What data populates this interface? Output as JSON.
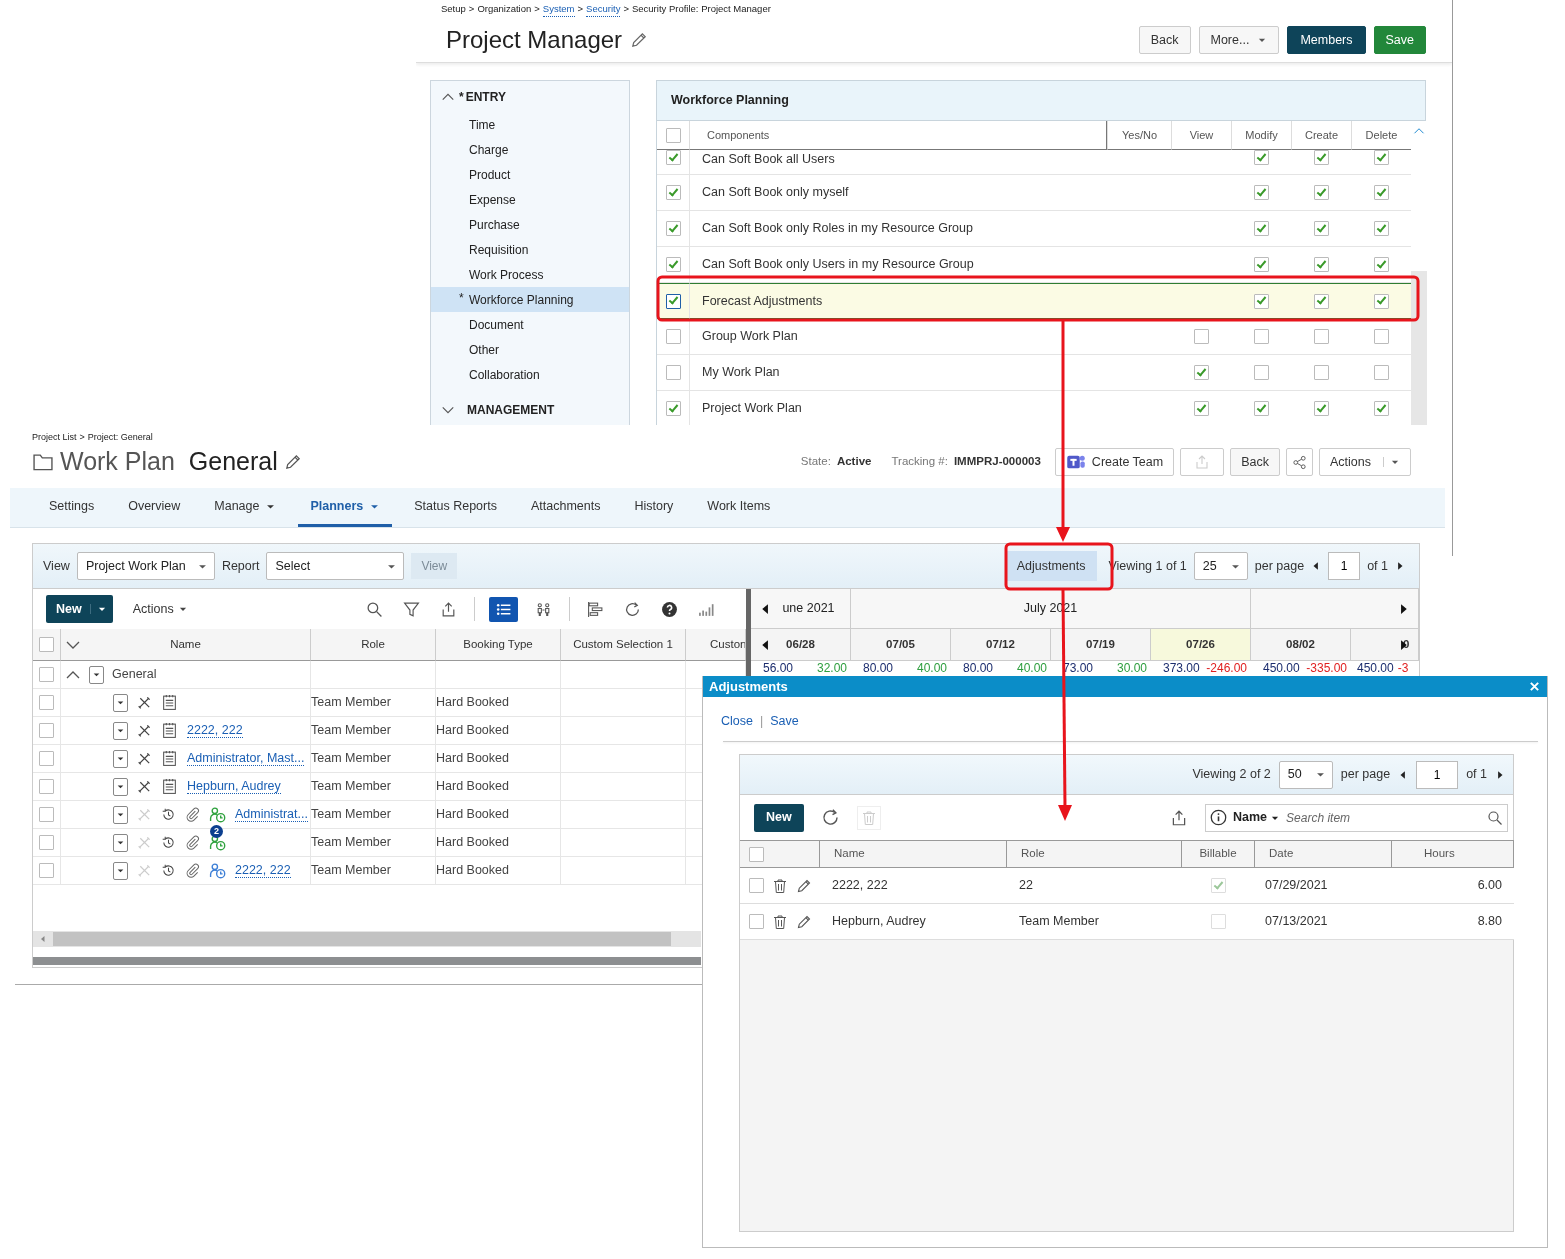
{
  "security_profile": {
    "breadcrumb": {
      "separator": ">",
      "items": [
        {
          "text": "Setup",
          "link": false
        },
        {
          "text": "Organization",
          "link": false
        },
        {
          "text": "System",
          "link": true
        },
        {
          "text": "Security",
          "link": true
        },
        {
          "text": "Security Profile: Project Manager",
          "link": false
        }
      ]
    },
    "title": "Project Manager",
    "buttons": [
      {
        "label": "Back",
        "kind": "default"
      },
      {
        "label": "More...",
        "kind": "dropdown"
      },
      {
        "label": "Members",
        "kind": "dark"
      },
      {
        "label": "Save",
        "kind": "success"
      }
    ],
    "required_mark": "*",
    "sidebar": [
      {
        "label": "ENTRY",
        "required": true,
        "expanded": true,
        "items": [
          {
            "label": "Time",
            "required": false,
            "selected": false
          },
          {
            "label": "Charge",
            "required": false,
            "selected": false
          },
          {
            "label": "Product",
            "required": false,
            "selected": false
          },
          {
            "label": "Expense",
            "required": false,
            "selected": false
          },
          {
            "label": "Purchase",
            "required": false,
            "selected": false
          },
          {
            "label": "Requisition",
            "required": false,
            "selected": false
          },
          {
            "label": "Work Process",
            "required": false,
            "selected": false
          },
          {
            "label": "Workforce Planning",
            "required": true,
            "selected": true
          },
          {
            "label": "Document",
            "required": false,
            "selected": false
          },
          {
            "label": "Other",
            "required": false,
            "selected": false
          },
          {
            "label": "Collaboration",
            "required": false,
            "selected": false
          }
        ]
      },
      {
        "label": "MANAGEMENT",
        "required": false,
        "expanded": false
      }
    ],
    "panel": {
      "title": "Workforce Planning",
      "header_checked": false,
      "columns": [
        "Components",
        "Yes/No",
        "View",
        "Modify",
        "Create",
        "Delete"
      ],
      "rows": [
        {
          "label": "Can Soft Book all Users",
          "checked": true,
          "selected": false,
          "permissions": {
            "modify": true,
            "create": true,
            "delete": true
          }
        },
        {
          "label": "Can Soft Book only myself",
          "checked": true,
          "selected": false,
          "permissions": {
            "modify": true,
            "create": true,
            "delete": true
          }
        },
        {
          "label": "Can Soft Book only Roles in my Resource Group",
          "checked": true,
          "selected": false,
          "permissions": {
            "modify": true,
            "create": true,
            "delete": true
          }
        },
        {
          "label": "Can Soft Book only Users in my Resource Group",
          "checked": true,
          "selected": false,
          "permissions": {
            "modify": true,
            "create": true,
            "delete": true
          }
        },
        {
          "label": "Forecast Adjustments",
          "checked": true,
          "selected": true,
          "permissions": {
            "modify": true,
            "create": true,
            "delete": true
          }
        },
        {
          "label": "Group Work Plan",
          "checked": false,
          "selected": false,
          "permissions": {
            "view": false,
            "modify": false,
            "create": false,
            "delete": false
          }
        },
        {
          "label": "My Work Plan",
          "checked": false,
          "selected": false,
          "permissions": {
            "view": true,
            "modify": false,
            "create": false,
            "delete": false
          }
        },
        {
          "label": "Project Work Plan",
          "checked": true,
          "selected": false,
          "permissions": {
            "view": true,
            "modify": true,
            "create": true,
            "delete": true
          }
        }
      ]
    }
  },
  "work_plan": {
    "breadcrumb": {
      "separator": ">",
      "items": [
        {
          "text": "Project List",
          "link": false
        },
        {
          "text": "Project: General",
          "link": false
        }
      ]
    },
    "title_prefix": "Work Plan",
    "title": "General",
    "state_label": "State:",
    "state": "Active",
    "tracking_label": "Tracking #:",
    "tracking": "IMMPRJ-000003",
    "buttons": [
      {
        "label": "Create Team",
        "kind": "teams"
      },
      {
        "kind": "upload",
        "disabled": true
      },
      {
        "label": "Back",
        "kind": "default"
      },
      {
        "kind": "share"
      },
      {
        "label": "Actions",
        "kind": "split"
      }
    ],
    "tabs": [
      {
        "label": "Settings",
        "selected": false,
        "dropdown": false
      },
      {
        "label": "Overview",
        "selected": false,
        "dropdown": false
      },
      {
        "label": "Manage",
        "selected": false,
        "dropdown": true
      },
      {
        "label": "Planners",
        "selected": true,
        "dropdown": true
      },
      {
        "label": "Status Reports",
        "selected": false,
        "dropdown": false
      },
      {
        "label": "Attachments",
        "selected": false,
        "dropdown": false
      },
      {
        "label": "History",
        "selected": false,
        "dropdown": false
      },
      {
        "label": "Work Items",
        "selected": false,
        "dropdown": false
      }
    ],
    "toolbar": {
      "view_label": "View",
      "view_select": "Project Work Plan",
      "report_label": "Report",
      "report_select": "Select",
      "view_button": {
        "label": "View",
        "disabled": true
      },
      "adjustments_button": "Adjustments",
      "viewing": "Viewing 1 of 1",
      "per_page": "25",
      "per_page_label": "per page",
      "page": "1",
      "page_total": "of 1"
    },
    "grid": {
      "new_button": "New",
      "actions_button": "Actions",
      "header_checked": false,
      "columns": [
        "Name",
        "Role",
        "Booking Type",
        "Custom Selection 1",
        "Custon"
      ],
      "group": {
        "label": "General",
        "expanded": true,
        "checked": false
      },
      "rows": [
        {
          "kind": "resource",
          "checked": false,
          "role": "Team Member",
          "booking": "Hard Booked"
        },
        {
          "kind": "resource",
          "checked": false,
          "name": "2222, 222",
          "role": "Team Member",
          "booking": "Hard Booked"
        },
        {
          "kind": "resource",
          "checked": false,
          "name": "Administrator, Mast...",
          "role": "Team Member",
          "booking": "Hard Booked"
        },
        {
          "kind": "resource",
          "checked": false,
          "name": "Hepburn, Audrey",
          "role": "Team Member",
          "booking": "Hard Booked"
        },
        {
          "kind": "assignment",
          "checked": false,
          "name": "Administrat...",
          "color": "#2fa23e",
          "role": "Team Member",
          "booking": "Hard Booked"
        },
        {
          "kind": "assignment",
          "checked": false,
          "color": "#2fa23e",
          "badge": "2",
          "role": "Team Member",
          "booking": "Hard Booked"
        },
        {
          "kind": "assignment",
          "checked": false,
          "name": "2222, 222",
          "color": "#3d7fd6",
          "role": "Team Member",
          "booking": "Hard Booked"
        }
      ]
    },
    "timeline": {
      "months": [
        {
          "label": "une 2021",
          "weeks": [
            {
              "label": "06/28",
              "current": false,
              "values": [
                {
                  "text": "56.00",
                  "color": "#1c2d6e"
                },
                {
                  "text": "32.00",
                  "color": "#2e9e3e"
                }
              ]
            }
          ]
        },
        {
          "label": "July 2021",
          "weeks": [
            {
              "label": "07/05",
              "current": false,
              "values": [
                {
                  "text": "80.00",
                  "color": "#1c2d6e"
                },
                {
                  "text": "40.00",
                  "color": "#2e9e3e"
                }
              ]
            },
            {
              "label": "07/12",
              "current": false,
              "values": [
                {
                  "text": "80.00",
                  "color": "#1c2d6e"
                },
                {
                  "text": "40.00",
                  "color": "#2e9e3e"
                }
              ]
            },
            {
              "label": "07/19",
              "current": false,
              "values": [
                {
                  "text": "73.00",
                  "color": "#1c2d6e"
                },
                {
                  "text": "30.00",
                  "color": "#2e9e3e"
                }
              ]
            },
            {
              "label": "07/26",
              "current": true,
              "values": [
                {
                  "text": "373.00",
                  "color": "#1c2d6e"
                },
                {
                  "text": "-246.00",
                  "color": "#e02020"
                }
              ]
            }
          ]
        },
        {
          "weeks": [
            {
              "label": "08/02",
              "current": false,
              "values": [
                {
                  "text": "450.00",
                  "color": "#1c2d6e"
                },
                {
                  "text": "-335.00",
                  "color": "#e02020"
                }
              ]
            },
            {
              "label": "0",
              "current": false,
              "values": [
                {
                  "text": "450.00",
                  "color": "#1c2d6e"
                },
                {
                  "text": "-3",
                  "color": "#e02020"
                }
              ]
            }
          ]
        }
      ]
    }
  },
  "adjustments": {
    "title": "Adjustments",
    "links": [
      "Close",
      "Save"
    ],
    "link_separator": "|",
    "viewing": "Viewing 2 of 2",
    "per_page": "50",
    "per_page_label": "per page",
    "page": "1",
    "page_total": "of 1",
    "new_button": "New",
    "search_field": "Name",
    "search_placeholder": "Search item",
    "header_checked": false,
    "columns": [
      "Name",
      "Role",
      "Billable",
      "Date",
      "Hours"
    ],
    "rows": [
      {
        "checked": false,
        "name": "2222, 222",
        "role": "22",
        "billable": true,
        "date": "07/29/2021",
        "hours": "6.00"
      },
      {
        "checked": false,
        "name": "Hepburn, Audrey",
        "role": "Team Member",
        "billable": false,
        "date": "07/13/2021",
        "hours": "8.80"
      }
    ]
  }
}
